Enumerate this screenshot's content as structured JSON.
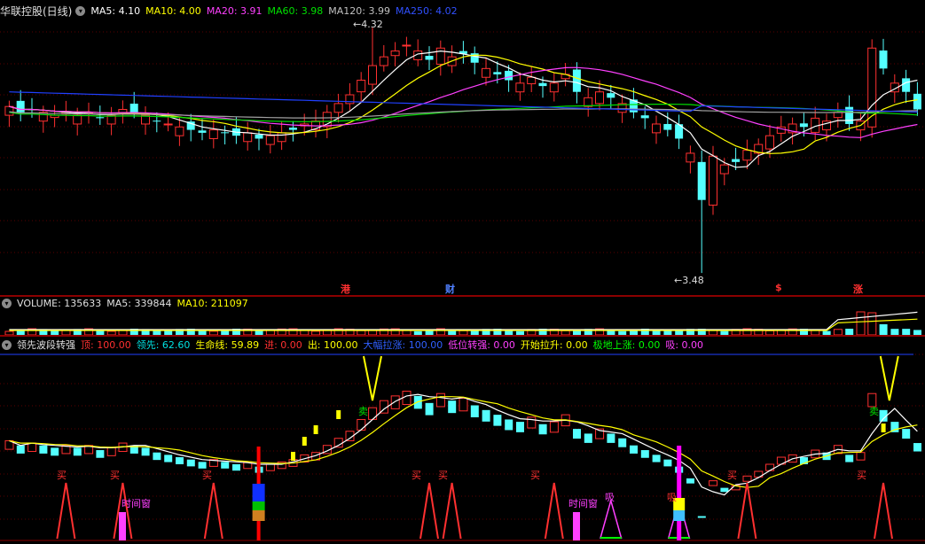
{
  "header_main": {
    "title": "华联控股(日线)",
    "ma5": "MA5: 4.10",
    "ma10": "MA10: 4.00",
    "ma20": "MA20: 3.91",
    "ma60": "MA60: 3.98",
    "ma120": "MA120: 3.99",
    "ma250": "MA250: 4.02"
  },
  "header_volume": {
    "title": "VOLUME: 135633",
    "ma5": "MA5: 339844",
    "ma10": "MA10: 211097"
  },
  "header_indicator": {
    "title": "领先波段转强",
    "items": [
      {
        "text": "顶: 100.00",
        "color": "#ff3030"
      },
      {
        "text": "领先: 62.60",
        "color": "#00e0e0"
      },
      {
        "text": "生命线: 59.89",
        "color": "#ffff00"
      },
      {
        "text": "进: 0.00",
        "color": "#ff3030"
      },
      {
        "text": "出: 100.00",
        "color": "#ffff00"
      },
      {
        "text": "大幅拉涨: 100.00",
        "color": "#3060ff"
      },
      {
        "text": "低位转强: 0.00",
        "color": "#ff40ff"
      },
      {
        "text": "开始拉升: 0.00",
        "color": "#ffff00"
      },
      {
        "text": "极地上涨: 0.00",
        "color": "#00ff00"
      },
      {
        "text": "吸: 0.00",
        "color": "#ff40ff"
      }
    ]
  },
  "price_labels": {
    "high": "4.32",
    "low": "3.48"
  },
  "event_markers": [
    "港",
    "财",
    "$",
    "涨"
  ],
  "signal_labels": {
    "buy": "买",
    "sell": "卖",
    "time_window": "时间窗",
    "absorb": "吸"
  },
  "colors": {
    "up": "#ff3030",
    "down": "#54ffff",
    "ma5": "#ffffff",
    "ma10": "#ffff00",
    "ma20": "#ff40ff",
    "ma60": "#00e000",
    "ma120": "#a0a0a0",
    "ma250": "#2040ff"
  },
  "chart_data": {
    "type": "candlestick",
    "price_series": [
      4.05,
      4.03,
      4.04,
      4.03,
      4.02,
      4.03,
      4.02,
      4.03,
      4.01,
      4.02,
      4.04,
      4.03,
      4.02,
      4.0,
      3.99,
      3.98,
      3.97,
      3.96,
      3.97,
      3.96,
      3.95,
      3.96,
      3.94,
      3.95,
      3.96,
      3.97,
      3.99,
      4.0,
      4.03,
      4.06,
      4.09,
      4.14,
      4.19,
      4.22,
      4.24,
      4.26,
      4.24,
      4.21,
      4.25,
      4.22,
      4.23,
      4.2,
      4.18,
      4.16,
      4.14,
      4.13,
      4.15,
      4.12,
      4.13,
      4.16,
      4.1,
      4.08,
      4.1,
      4.08,
      4.06,
      4.03,
      4.01,
      3.99,
      3.97,
      3.94,
      3.89,
      3.73,
      3.88,
      3.85,
      3.86,
      3.9,
      3.92,
      3.95,
      3.98,
      3.99,
      3.98,
      4.01,
      4.0,
      4.03,
      3.99,
      4.0,
      4.25,
      4.18,
      4.13,
      4.1,
      4.04
    ],
    "high_marker": 4.32,
    "low_marker": 3.48
  }
}
